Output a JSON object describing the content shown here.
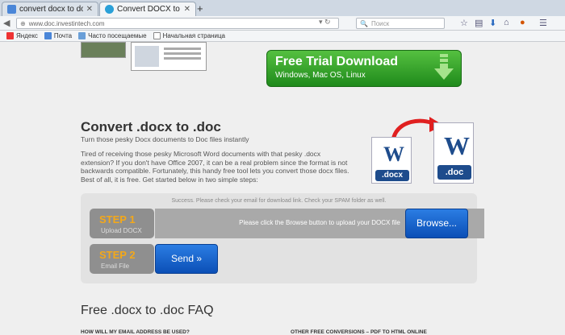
{
  "browser": {
    "tabs": [
      {
        "title": "convert docx to doc - Пои...",
        "active": false
      },
      {
        "title": "Convert DOCX to DOC Onl...",
        "active": true
      }
    ],
    "new_tab": "+",
    "url": "www.doc.investintech.com",
    "search_placeholder": "Поиск",
    "bookmarks": [
      "Яндекс",
      "Почта",
      "Часто посещаемые",
      "Начальная страница"
    ]
  },
  "page": {
    "trial": {
      "title": "Free Trial Download",
      "subtitle": "Windows, Mac OS, Linux"
    },
    "heading": "Convert .docx to .doc",
    "subheading": "Turn those pesky Docx documents to Doc files instantly",
    "description": "Tired of receiving those pesky Microsoft Word documents with that pesky .docx extension? If you don't have Office 2007, it can be a real problem since the format is not backwards compatible. Fortunately, this handy free tool lets you convert those docx files. Best of all, it is free. Get started below in two simple steps:",
    "icons": {
      "letter": "W",
      "from_ext": ".docx",
      "to_ext": ".doc"
    },
    "converter": {
      "success_message": "Success. Please check your email for download link. Check your SPAM folder as well.",
      "step1": {
        "title": "STEP 1",
        "subtitle": "Upload DOCX"
      },
      "upload_hint": "Please click the Browse button to upload your DOCX file",
      "browse_label": "Browse...",
      "step2": {
        "title": "STEP 2",
        "subtitle": "Email File"
      },
      "send_label": "Send »"
    },
    "faq": {
      "title": "Free .docx to .doc FAQ",
      "question_left": "HOW WILL MY EMAIL ADDRESS BE USED?",
      "question_right": "OTHER FREE CONVERSIONS – PDF TO HTML ONLINE"
    }
  },
  "colors": {
    "trial_green": "#2ea12a",
    "step_orange": "#f3a81a",
    "button_blue": "#0b5fd0",
    "word_blue": "#1e4c8c"
  }
}
